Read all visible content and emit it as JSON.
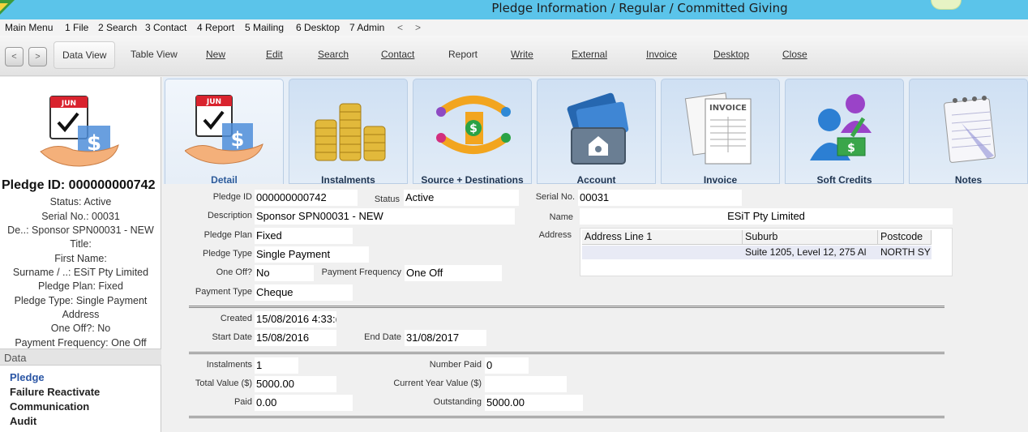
{
  "window": {
    "title": "Pledge Information / Regular / Committed Giving"
  },
  "menu": [
    "Main Menu",
    "1 File",
    "2 Search",
    "3 Contact",
    "4 Report",
    "5 Mailing",
    "6 Desktop",
    "7 Admin",
    "<",
    ">"
  ],
  "toolbar": {
    "back": "<",
    "forward": ">",
    "data_view": "Data View",
    "table_view": "Table View",
    "new": "New",
    "edit": "Edit",
    "search": "Search",
    "contact": "Contact",
    "report": "Report",
    "write": "Write",
    "external": "External",
    "invoice": "Invoice",
    "desktop": "Desktop",
    "close": "Close"
  },
  "summary": {
    "pledge_id": "Pledge ID: 000000000742",
    "lines": [
      "Status: Active",
      "Serial No.: 00031",
      "De..: Sponsor SPN00031 - NEW",
      "Title:",
      "First Name:",
      "Surname / ..: ESiT Pty Limited",
      "Pledge Plan: Fixed",
      "Pledge Type: Single Payment",
      "Address",
      "One Off?: No",
      "Payment Frequency: One Off"
    ]
  },
  "data_nav": {
    "header": "Data",
    "items": [
      "Pledge",
      "Failure Reactivate",
      "Communication",
      "Audit"
    ]
  },
  "tabs": [
    "Detail",
    "Instalments",
    "Source + Destinations",
    "Account",
    "Invoice",
    "Soft Credits",
    "Notes"
  ],
  "form": {
    "pledge_id_label": "Pledge ID",
    "pledge_id": "000000000742",
    "status_label": "Status",
    "status": "Active",
    "serial_label": "Serial No.",
    "serial": "00031",
    "description_label": "Description",
    "description": "Sponsor SPN00031 - NEW",
    "name_label": "Name",
    "name": "ESiT Pty Limited",
    "plan_label": "Pledge Plan",
    "plan": "Fixed",
    "address_label": "Address",
    "type_label": "Pledge Type",
    "type": "Single Payment",
    "oneoff_label": "One Off?",
    "oneoff": "No",
    "freq_label": "Payment Frequency",
    "freq": "One Off",
    "paytype_label": "Payment Type",
    "paytype": "Cheque",
    "created_label": "Created",
    "created": "15/08/2016 4:33:(",
    "start_label": "Start Date",
    "start": "15/08/2016",
    "end_label": "End Date",
    "end": "31/08/2017",
    "instalments_label": "Instalments",
    "instalments": "1",
    "numpaid_label": "Number Paid",
    "numpaid": "0",
    "total_label": "Total Value ($)",
    "total": "5000.00",
    "curyear_label": "Current Year Value ($)",
    "curyear": "",
    "paid_label": "Paid",
    "paid": "0.00",
    "outstanding_label": "Outstanding",
    "outstanding": "5000.00"
  },
  "address_table": {
    "headers": [
      "Address Line 1",
      "Suburb",
      "Postcode"
    ],
    "row": [
      "",
      "Suite 1205, Level 12, 275 Al",
      "NORTH SY"
    ]
  }
}
